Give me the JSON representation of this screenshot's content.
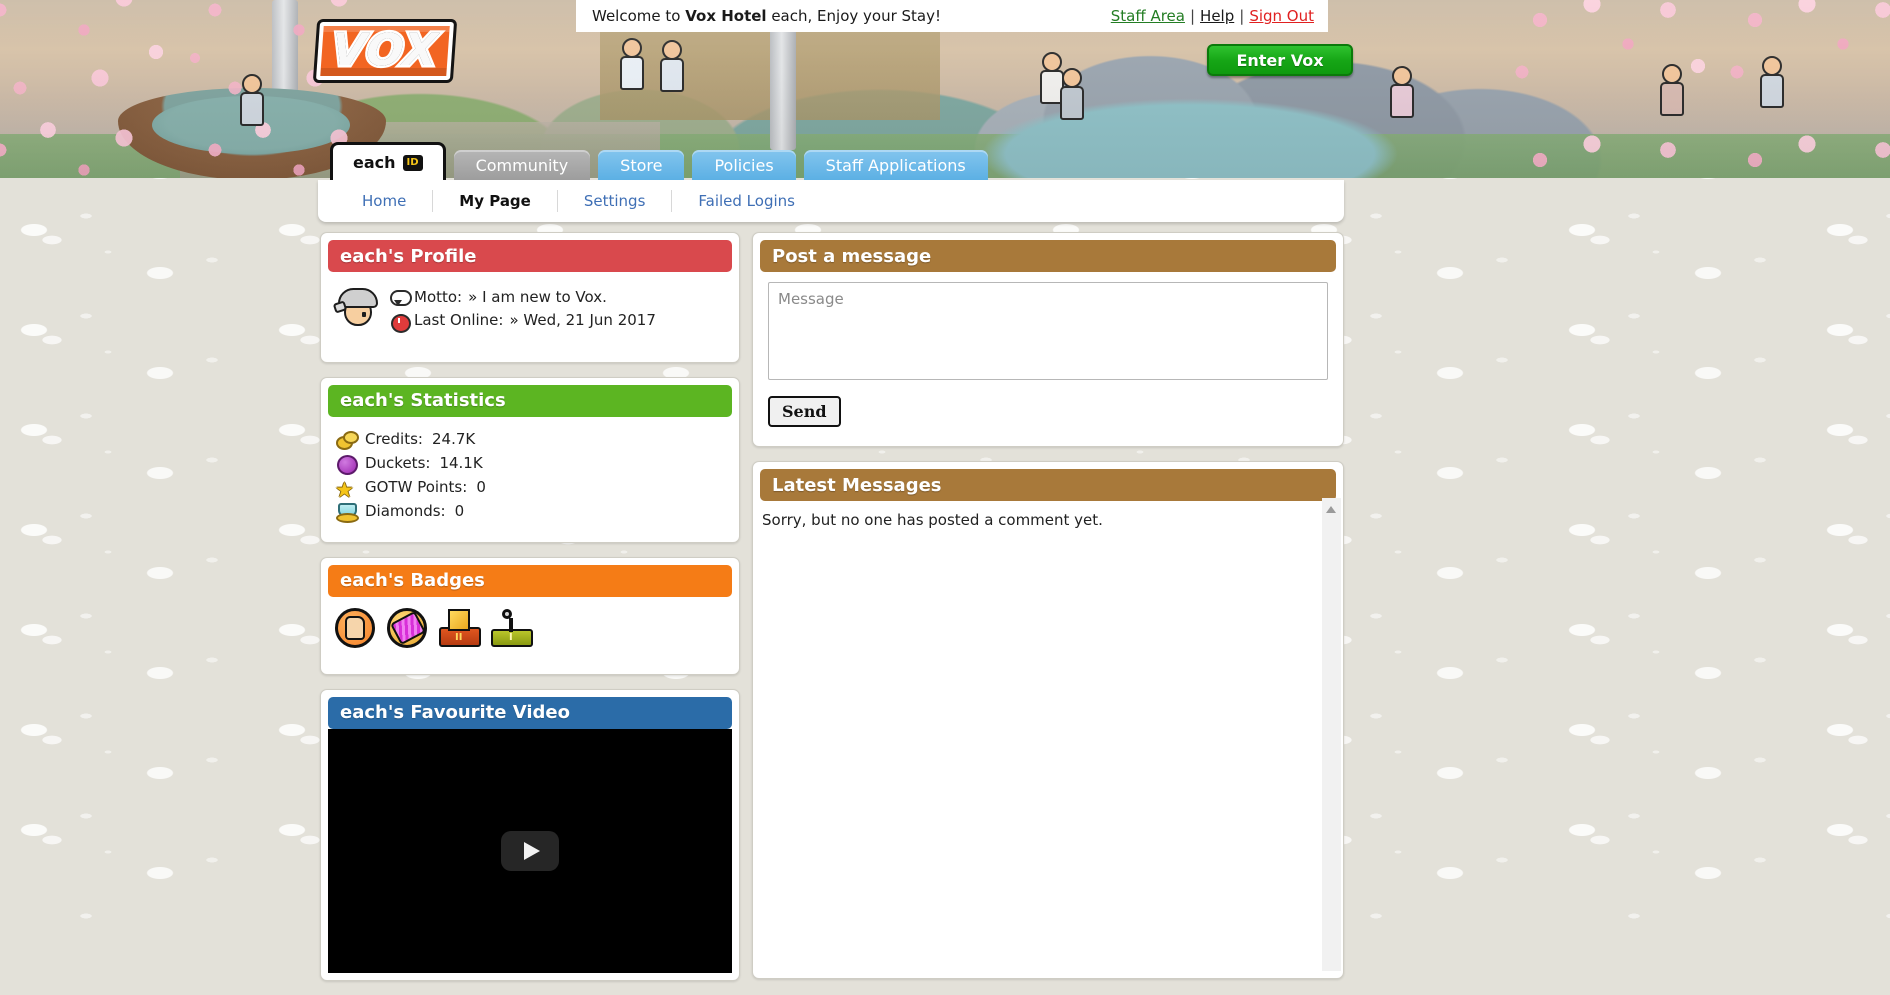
{
  "welcome": {
    "prefix": "Welcome to ",
    "brand": "Vox Hotel",
    "suffix": " each, Enjoy your Stay!",
    "staff_area": "Staff Area",
    "help": "Help",
    "sign_out": "Sign Out",
    "separator": "|"
  },
  "logo": {
    "text": "VOX"
  },
  "enter_button": {
    "label": "Enter Vox"
  },
  "main_tabs": [
    {
      "label": "each",
      "badge": "ID",
      "state": "active"
    },
    {
      "label": "Community",
      "state": "gray"
    },
    {
      "label": "Store",
      "state": "blue"
    },
    {
      "label": "Policies",
      "state": "blue"
    },
    {
      "label": "Staff Applications",
      "state": "blue"
    }
  ],
  "sub_nav": [
    {
      "label": "Home",
      "active": false
    },
    {
      "label": "My Page",
      "active": true
    },
    {
      "label": "Settings",
      "active": false
    },
    {
      "label": "Failed Logins",
      "active": false
    }
  ],
  "profile_panel": {
    "title": "each's Profile",
    "color": "#d9494d",
    "motto_label": "Motto:",
    "motto_value": "» I am new to Vox.",
    "last_online_label": "Last Online:",
    "last_online_value": "» Wed, 21 Jun 2017"
  },
  "statistics_panel": {
    "title": "each's Statistics",
    "color": "#5cb522",
    "rows": [
      {
        "icon": "credits-icon",
        "label": "Credits:",
        "value": "24.7K"
      },
      {
        "icon": "duckets-icon",
        "label": "Duckets:",
        "value": "14.1K"
      },
      {
        "icon": "gotw-star-icon",
        "label": "GOTW Points:",
        "value": "0"
      },
      {
        "icon": "diamonds-icon",
        "label": "Diamonds:",
        "value": "0"
      }
    ]
  },
  "badges_panel": {
    "title": "each's Badges",
    "color": "#f57c16",
    "badges": [
      {
        "name": "thumbs-up-badge-icon"
      },
      {
        "name": "comb-badge-icon"
      },
      {
        "name": "gold-cube-badge-icon"
      },
      {
        "name": "key-badge-icon"
      }
    ]
  },
  "video_panel": {
    "title": "each's Favourite Video",
    "color": "#2b6ca8",
    "play_icon": "youtube-play-icon"
  },
  "post_panel": {
    "title": "Post a message",
    "color": "#a8793a",
    "textarea_placeholder": "Message",
    "textarea_value": "",
    "send_label": "Send"
  },
  "latest_panel": {
    "title": "Latest Messages",
    "color": "#a8793a",
    "empty_text": "Sorry, but no one has posted a comment yet."
  }
}
